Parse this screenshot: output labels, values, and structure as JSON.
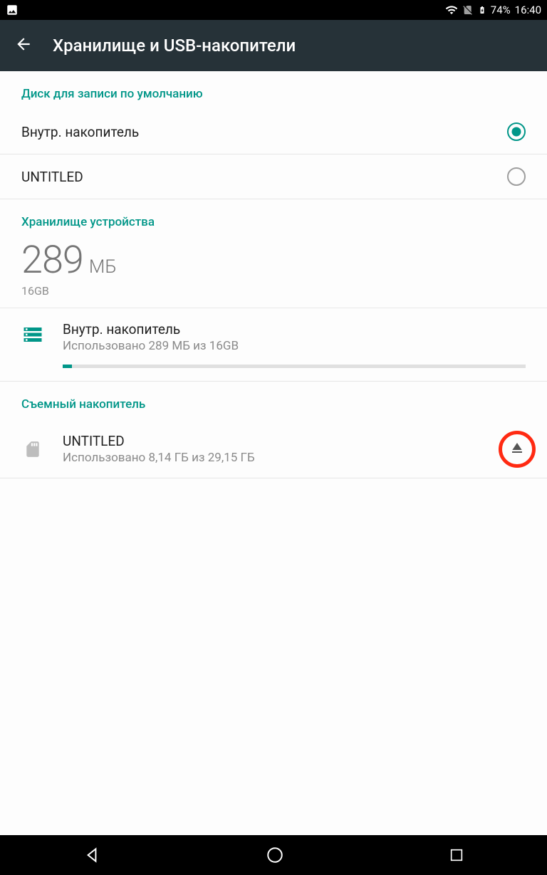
{
  "statusbar": {
    "battery_pct": "74%",
    "time": "16:40"
  },
  "appbar": {
    "title": "Хранилище и USB-накопители"
  },
  "section_default_disk": "Диск для записи по умолчанию",
  "default_options": {
    "internal": "Внутр. накопитель",
    "untitled": "UNTITLED"
  },
  "section_device_storage": "Хранилище устройства",
  "used_value": "289",
  "used_unit": "МБ",
  "total_capacity": "16GB",
  "internal_item": {
    "title": "Внутр. накопитель",
    "sub": "Использовано 289 МБ из 16GB"
  },
  "section_removable": "Съемный накопитель",
  "removable_item": {
    "title": "UNTITLED",
    "sub": "Использовано 8,14 ГБ из 29,15 ГБ"
  }
}
